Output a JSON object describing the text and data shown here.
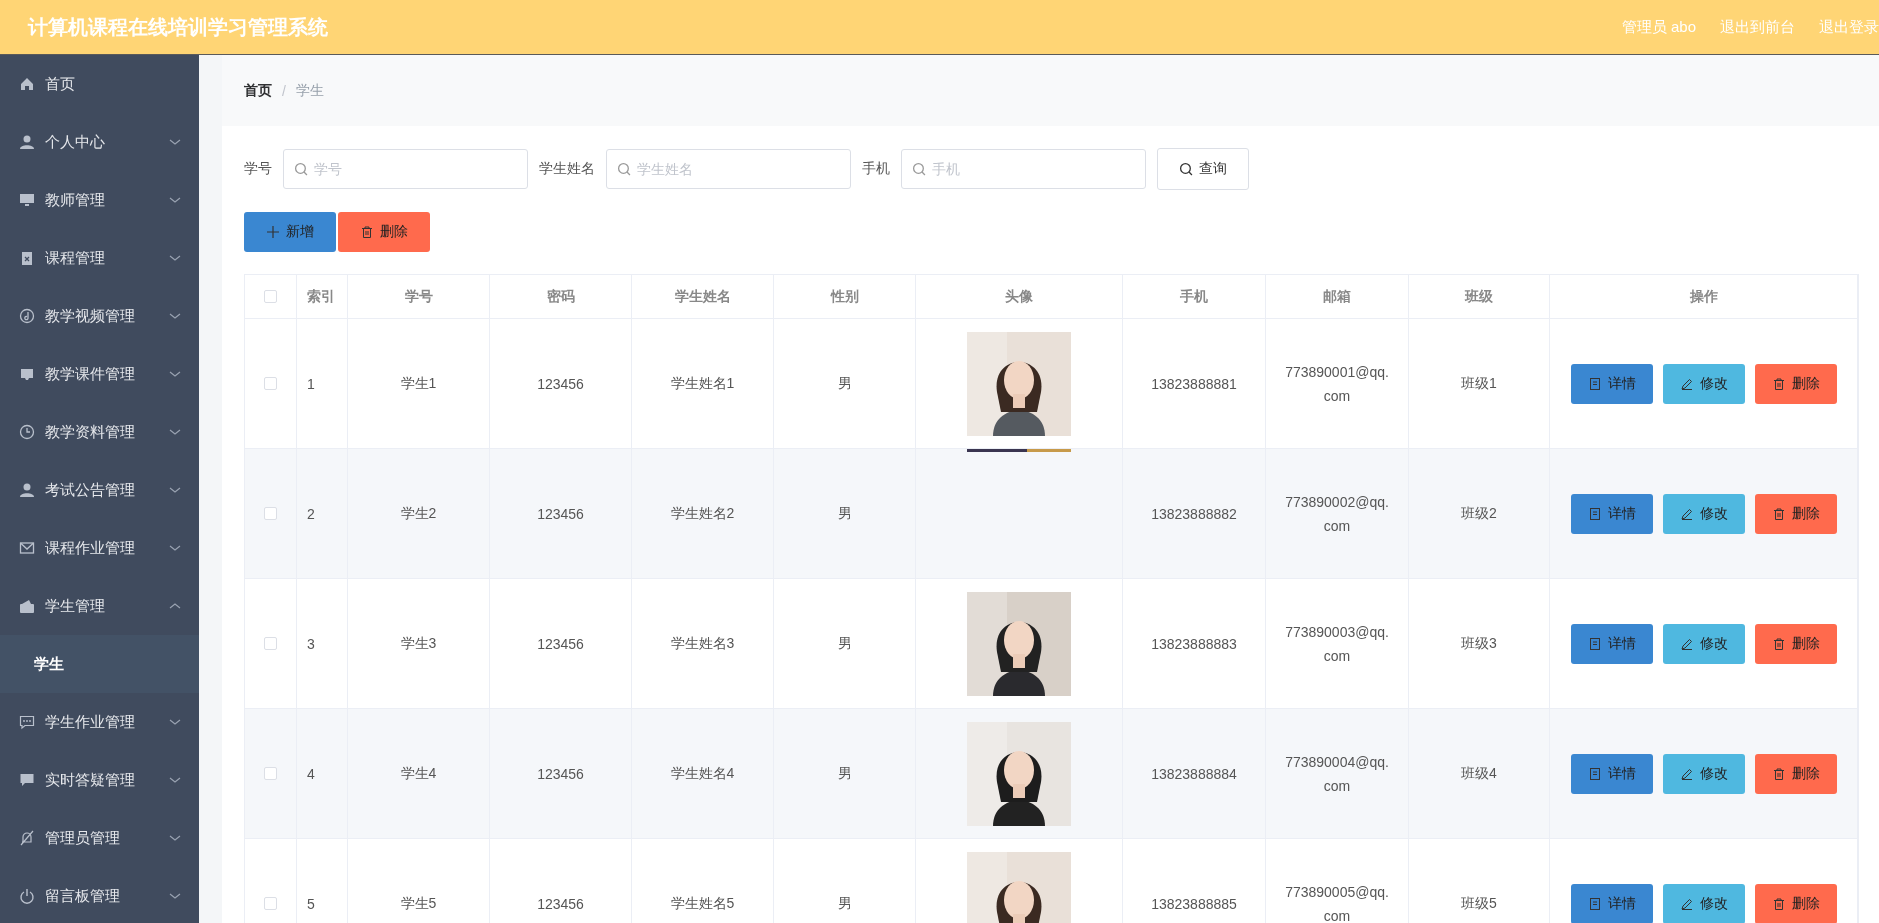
{
  "header": {
    "title": "计算机课程在线培训学习管理系统",
    "user": "管理员 abo",
    "links": [
      "退出到前台",
      "退出登录"
    ]
  },
  "sidebar": {
    "items": [
      {
        "label": "首页"
      },
      {
        "label": "个人中心",
        "expanded": false
      },
      {
        "label": "教师管理",
        "expanded": false
      },
      {
        "label": "课程管理",
        "expanded": false
      },
      {
        "label": "教学视频管理",
        "expanded": false
      },
      {
        "label": "教学课件管理",
        "expanded": false
      },
      {
        "label": "教学资料管理",
        "expanded": false
      },
      {
        "label": "考试公告管理",
        "expanded": false
      },
      {
        "label": "课程作业管理",
        "expanded": false
      },
      {
        "label": "学生管理",
        "expanded": true,
        "children": [
          {
            "label": "学生",
            "selected": true
          }
        ]
      },
      {
        "label": "学生作业管理",
        "expanded": false
      },
      {
        "label": "实时答疑管理",
        "expanded": false
      },
      {
        "label": "管理员管理",
        "expanded": false
      },
      {
        "label": "留言板管理",
        "expanded": false
      }
    ]
  },
  "breadcrumb": {
    "items": [
      "首页",
      "学生"
    ],
    "separator": "/"
  },
  "search": {
    "fields": [
      {
        "label": "学号",
        "placeholder": "学号"
      },
      {
        "label": "学生姓名",
        "placeholder": "学生姓名"
      },
      {
        "label": "手机",
        "placeholder": "手机"
      }
    ],
    "button": "查询"
  },
  "actions": [
    {
      "label": "新增",
      "kind": "add"
    },
    {
      "label": "删除",
      "kind": "delete"
    }
  ],
  "table": {
    "all_checked": false,
    "columns": [
      "索引",
      "学号",
      "密码",
      "学生姓名",
      "性别",
      "头像",
      "手机",
      "邮箱",
      "班级",
      "操作"
    ],
    "rows": [
      {
        "checked": false,
        "cells": [
          "1",
          "学生1",
          "123456",
          "学生姓名1",
          "男"
        ],
        "phone": "13823888881",
        "email": "773890001@qq.com",
        "class": "班级1",
        "buttons": [
          "详情",
          "修改",
          "删除"
        ]
      },
      {
        "checked": false,
        "cells": [
          "2",
          "学生2",
          "123456",
          "学生姓名2",
          "男"
        ],
        "avatar": {
          "kind": "broken"
        },
        "phone": "13823888882",
        "email": "773890002@qq.com",
        "class": "班级2",
        "buttons": [
          "详情",
          "修改",
          "删除"
        ]
      },
      {
        "checked": false,
        "cells": [
          "3",
          "学生3",
          "123456",
          "学生姓名3",
          "男"
        ],
        "phone": "13823888883",
        "email": "773890003@qq.com",
        "class": "班级3",
        "buttons": [
          "详情",
          "修改",
          "删除"
        ]
      },
      {
        "checked": false,
        "cells": [
          "4",
          "学生4",
          "123456",
          "学生姓名4",
          "男"
        ],
        "phone": "13823888884",
        "email": "773890004@qq.com",
        "class": "班级4",
        "buttons": [
          "详情",
          "修改",
          "删除"
        ]
      },
      {
        "checked": false,
        "cells": [
          "5",
          "学生5",
          "123456",
          "学生姓名5",
          "男"
        ],
        "phone": "13823888885",
        "email": "773890005@qq.com",
        "class": "班级5",
        "buttons": [
          "详情",
          "修改",
          "删除"
        ]
      }
    ]
  }
}
